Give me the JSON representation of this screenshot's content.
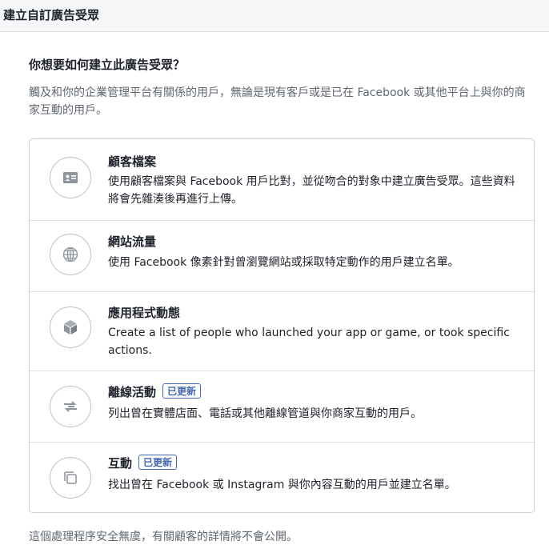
{
  "header": {
    "title": "建立自訂廣告受眾"
  },
  "question": "你想要如何建立此廣告受眾？",
  "description": "觸及和你的企業管理平台有關係的用戶，無論是現有客戶或是已在 Facebook 或其他平台上與你的商家互動的用戶。",
  "options": [
    {
      "icon": "contact-card-icon",
      "title": "顧客檔案",
      "description": "使用顧客檔案與 Facebook 用戶比對，並從吻合的對象中建立廣告受眾。這些資料將會先雜湊後再進行上傳。"
    },
    {
      "icon": "globe-icon",
      "title": "網站流量",
      "description": "使用 Facebook 像素針對曾瀏覽網站或採取特定動作的用戶建立名單。"
    },
    {
      "icon": "cube-icon",
      "title": "應用程式動態",
      "description": "Create a list of people who launched your app or game, or took specific actions."
    },
    {
      "icon": "offline-sync-icon",
      "title": "離線活動",
      "badge": "已更新",
      "description": "列出曾在實體店面、電話或其他離線管道與你商家互動的用戶。"
    },
    {
      "icon": "engagement-icon",
      "title": "互動",
      "badge": "已更新",
      "description": "找出曾在 Facebook 或 Instagram 與你內容互動的用戶並建立名單。"
    }
  ],
  "footer": "這個處理程序安全無虞，有關顧客的詳情將不會公開。",
  "colors": {
    "header_bg": "#f5f6f7",
    "border": "#ccd0d5",
    "icon_gray": "#90949c",
    "badge_blue": "#4267b2",
    "muted_text": "#606770"
  }
}
